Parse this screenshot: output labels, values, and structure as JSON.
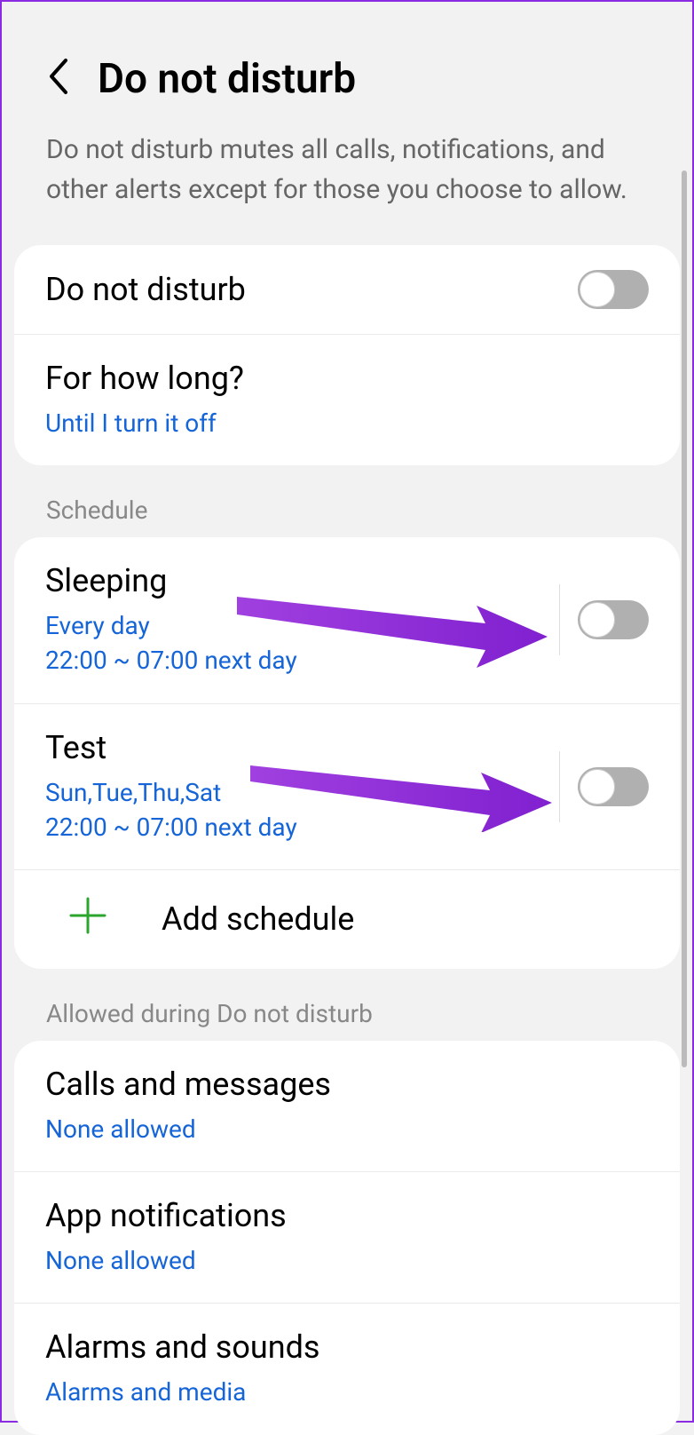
{
  "header": {
    "title": "Do not disturb"
  },
  "description": "Do not disturb mutes all calls, notifications, and other alerts except for those you choose to allow.",
  "main_toggle": {
    "label": "Do not disturb"
  },
  "duration": {
    "label": "For how long?",
    "value": "Until I turn it off"
  },
  "schedule_header": "Schedule",
  "schedules": [
    {
      "name": "Sleeping",
      "days": "Every day",
      "time": "22:00 ~ 07:00 next day"
    },
    {
      "name": "Test",
      "days": "Sun,Tue,Thu,Sat",
      "time": "22:00 ~ 07:00 next day"
    }
  ],
  "add_schedule": "Add schedule",
  "allowed_header": "Allowed during Do not disturb",
  "allowed": [
    {
      "label": "Calls and messages",
      "value": "None allowed"
    },
    {
      "label": "App notifications",
      "value": "None allowed"
    },
    {
      "label": "Alarms and sounds",
      "value": "Alarms and media"
    }
  ]
}
